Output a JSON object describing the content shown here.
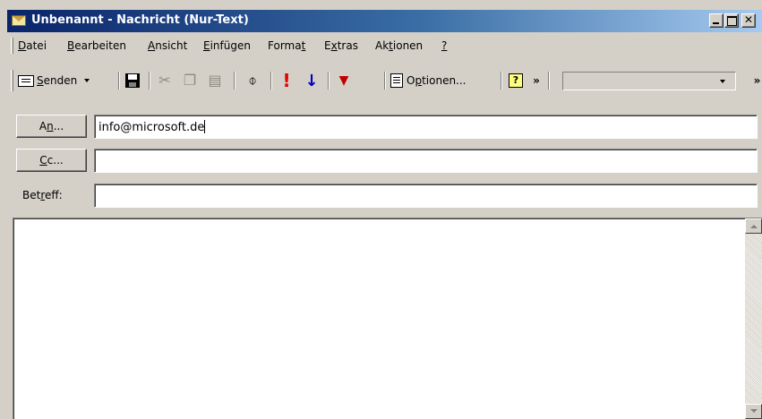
{
  "window": {
    "title": "Unbenannt - Nachricht (Nur-Text)"
  },
  "menubar": {
    "items": [
      {
        "pre": "",
        "key": "D",
        "post": "atei"
      },
      {
        "pre": "",
        "key": "B",
        "post": "earbeiten"
      },
      {
        "pre": "",
        "key": "A",
        "post": "nsicht"
      },
      {
        "pre": "",
        "key": "E",
        "post": "infügen"
      },
      {
        "pre": "Forma",
        "key": "t",
        "post": ""
      },
      {
        "pre": "E",
        "key": "x",
        "post": "tras"
      },
      {
        "pre": "Ak",
        "key": "t",
        "post": "ionen"
      },
      {
        "pre": "",
        "key": "?",
        "post": ""
      }
    ]
  },
  "toolbar": {
    "send": {
      "key": "S",
      "rest": "enden"
    },
    "options": {
      "pre": "O",
      "key": "p",
      "post": "tionen..."
    },
    "icons": [
      "send-envelope-icon",
      "save-icon",
      "cut-icon",
      "copy-icon",
      "paste-icon",
      "attach-icon",
      "importance-high-icon",
      "importance-low-icon",
      "flag-icon",
      "options-icon",
      "help-icon",
      "toolbar-overflow-icon"
    ],
    "dropdown_value": ""
  },
  "header": {
    "to": {
      "pre": "A",
      "key": "n",
      "post": "...",
      "value": "info@microsoft.de"
    },
    "cc": {
      "key": "C",
      "post": "c...",
      "value": ""
    },
    "subject": {
      "pre": "Bet",
      "key": "r",
      "post": "eff:",
      "value": ""
    }
  },
  "body": {
    "text": ""
  },
  "colors": {
    "face": "#d4d0c8",
    "titlebar_start": "#0a246a",
    "titlebar_end": "#a6caf0",
    "importance_high": "#e00000",
    "importance_low": "#0000c0"
  }
}
